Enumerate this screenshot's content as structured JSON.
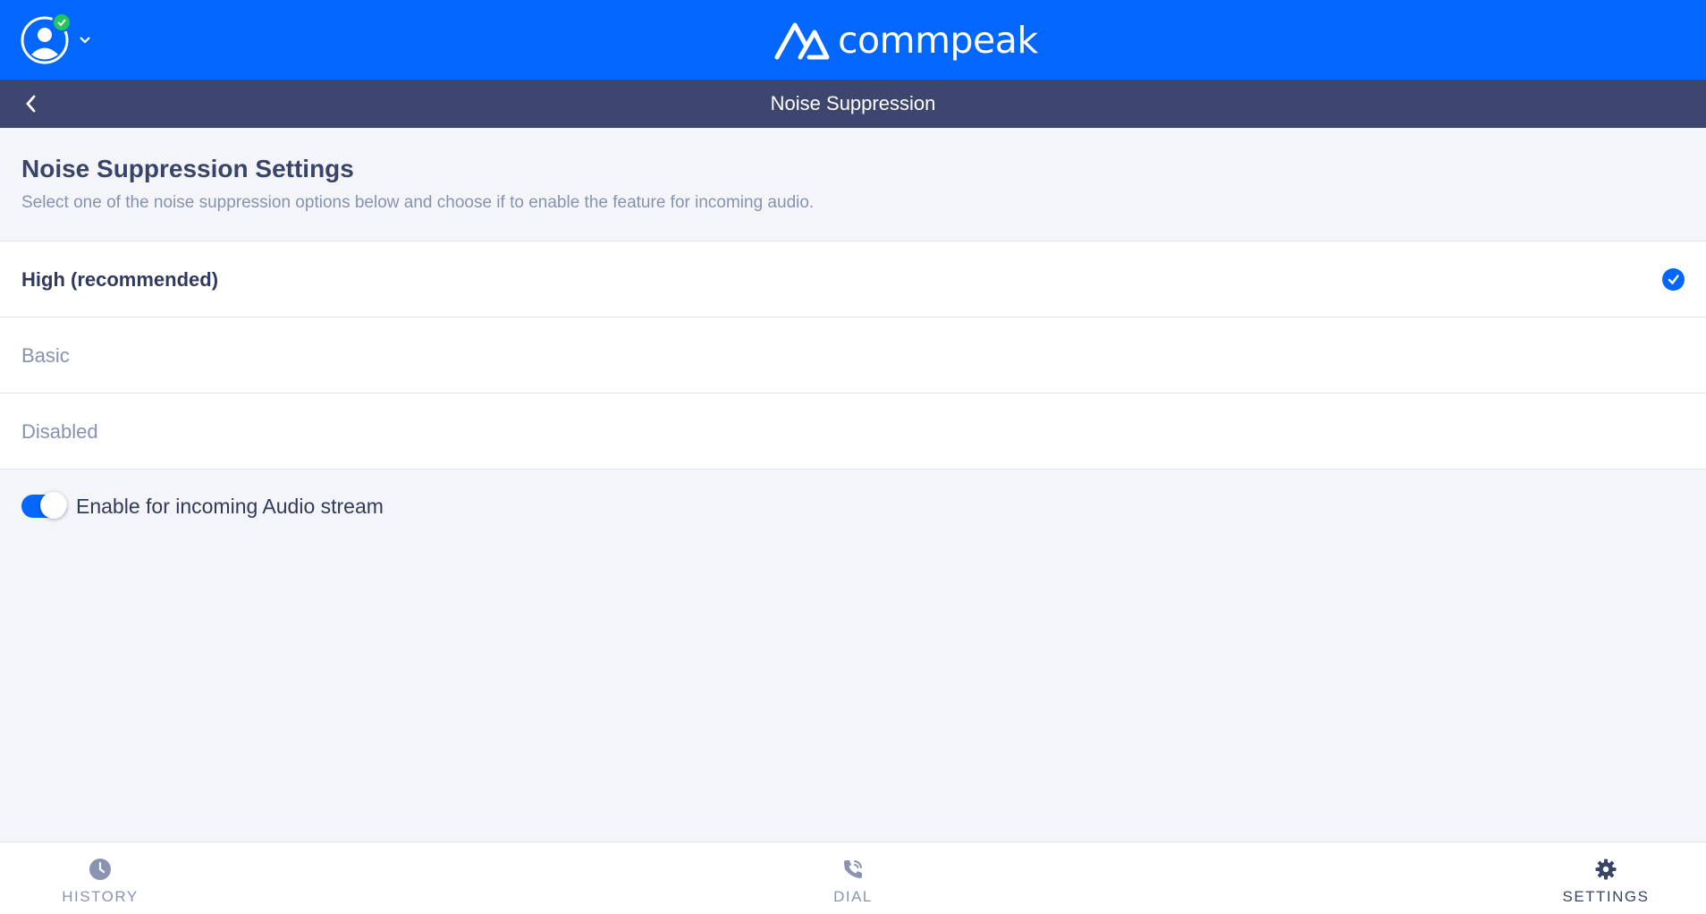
{
  "app": {
    "brand_name": "commpeak",
    "accent_color": "#0366fd",
    "header_color": "#3d466f"
  },
  "header": {
    "title": "Noise Suppression",
    "back_icon": "chevron-left-icon",
    "avatar_icon": "user-avatar-icon",
    "status": "online"
  },
  "section": {
    "title": "Noise Suppression Settings",
    "description": "Select one of the noise suppression options below and choose if to enable the feature for incoming audio."
  },
  "options": [
    {
      "label": "High (recommended)",
      "selected": true
    },
    {
      "label": "Basic",
      "selected": false
    },
    {
      "label": "Disabled",
      "selected": false
    }
  ],
  "incoming_toggle": {
    "label": "Enable for incoming Audio stream",
    "enabled": true
  },
  "bottom_nav": [
    {
      "label": "HISTORY",
      "icon": "clock-icon",
      "active": false
    },
    {
      "label": "DIAL",
      "icon": "phone-icon",
      "active": false
    },
    {
      "label": "SETTINGS",
      "icon": "gear-icon",
      "active": true
    }
  ]
}
